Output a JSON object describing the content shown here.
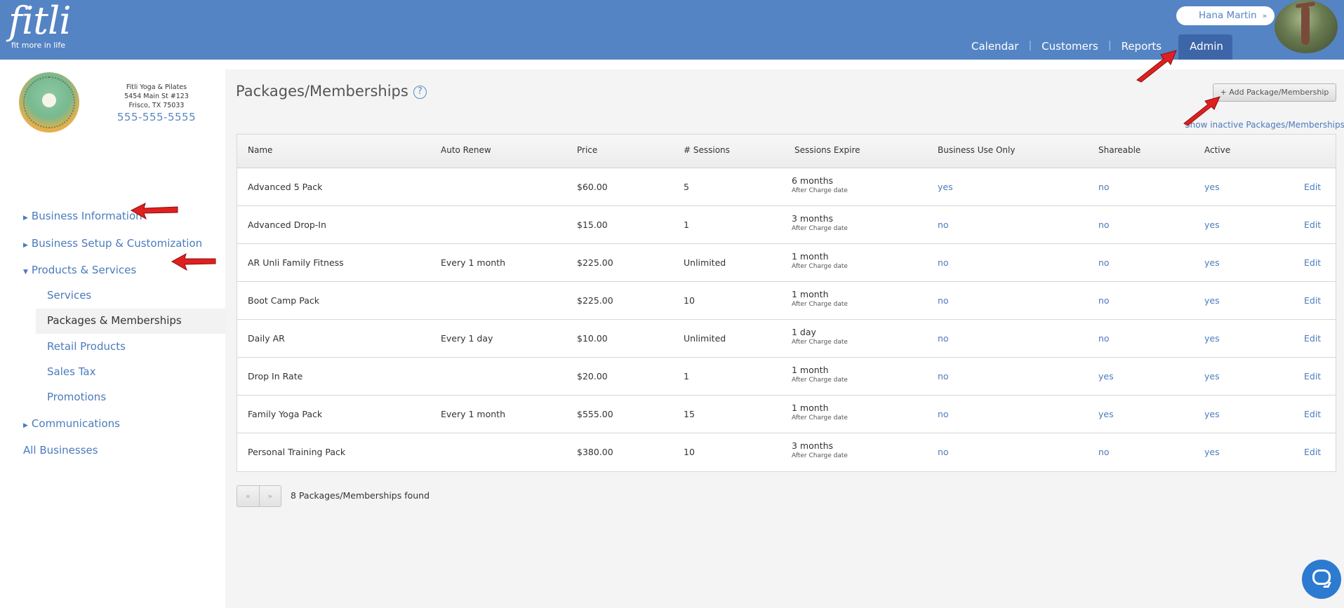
{
  "header": {
    "logo_word": "fitli",
    "logo_tagline": "fit more in life",
    "user_name": "Hana Martin",
    "user_chevron": "»",
    "nav": [
      {
        "label": "Calendar"
      },
      {
        "label": "Customers"
      },
      {
        "label": "Reports"
      },
      {
        "label": "Admin",
        "active": true
      }
    ],
    "nav_separator": "|"
  },
  "business": {
    "name": "Fitli Yoga & Pilates",
    "address1": "5454 Main St #123",
    "address2": "Frisco, TX 75033",
    "phone": "555-555-5555"
  },
  "sidebar": {
    "items": [
      {
        "label": "Business Information",
        "expanded": false
      },
      {
        "label": "Business Setup & Customization",
        "expanded": false
      },
      {
        "label": "Products & Services",
        "expanded": true
      },
      {
        "label": "Communications",
        "expanded": false
      },
      {
        "label": "All Businesses"
      }
    ],
    "subitems": [
      {
        "label": "Services"
      },
      {
        "label": "Packages & Memberships",
        "current": true
      },
      {
        "label": "Retail Products"
      },
      {
        "label": "Sales Tax"
      },
      {
        "label": "Promotions"
      }
    ]
  },
  "main": {
    "title": "Packages/Memberships",
    "help_icon": "?",
    "add_button": "+ Add Package/Membership",
    "show_inactive": "Show inactive Packages/Memberships",
    "columns": [
      "Name",
      "Auto Renew",
      "Price",
      "# Sessions",
      "Sessions Expire",
      "Business Use Only",
      "Shareable",
      "Active",
      ""
    ],
    "rows": [
      {
        "name": "Advanced 5 Pack",
        "auto_renew": "",
        "price": "$60.00",
        "sessions": "5",
        "expire": "6 months",
        "expire_note": "After Charge date",
        "business_use_only": "yes",
        "shareable": "no",
        "active": "yes",
        "action": "Edit"
      },
      {
        "name": "Advanced Drop-In",
        "auto_renew": "",
        "price": "$15.00",
        "sessions": "1",
        "expire": "3 months",
        "expire_note": "After Charge date",
        "business_use_only": "no",
        "shareable": "no",
        "active": "yes",
        "action": "Edit"
      },
      {
        "name": "AR Unli Family Fitness",
        "auto_renew": "Every 1 month",
        "price": "$225.00",
        "sessions": "Unlimited",
        "expire": "1 month",
        "expire_note": "After Charge date",
        "business_use_only": "no",
        "shareable": "no",
        "active": "yes",
        "action": "Edit"
      },
      {
        "name": "Boot Camp Pack",
        "auto_renew": "",
        "price": "$225.00",
        "sessions": "10",
        "expire": "1 month",
        "expire_note": "After Charge date",
        "business_use_only": "no",
        "shareable": "no",
        "active": "yes",
        "action": "Edit"
      },
      {
        "name": "Daily AR",
        "auto_renew": "Every 1 day",
        "price": "$10.00",
        "sessions": "Unlimited",
        "expire": "1 day",
        "expire_note": "After Charge date",
        "business_use_only": "no",
        "shareable": "no",
        "active": "yes",
        "action": "Edit"
      },
      {
        "name": "Drop In Rate",
        "auto_renew": "",
        "price": "$20.00",
        "sessions": "1",
        "expire": "1 month",
        "expire_note": "After Charge date",
        "business_use_only": "no",
        "shareable": "yes",
        "active": "yes",
        "action": "Edit"
      },
      {
        "name": "Family Yoga Pack",
        "auto_renew": "Every 1 month",
        "price": "$555.00",
        "sessions": "15",
        "expire": "1 month",
        "expire_note": "After Charge date",
        "business_use_only": "no",
        "shareable": "yes",
        "active": "yes",
        "action": "Edit"
      },
      {
        "name": "Personal Training Pack",
        "auto_renew": "",
        "price": "$380.00",
        "sessions": "10",
        "expire": "3 months",
        "expire_note": "After Charge date",
        "business_use_only": "no",
        "shareable": "no",
        "active": "yes",
        "action": "Edit"
      }
    ],
    "pager_prev": "«",
    "pager_next": "»",
    "found_text": "8 Packages/Memberships found"
  },
  "colors": {
    "header_bg": "#5584c4",
    "active_tab_bg": "#3d66a8",
    "link": "#4a7bbd",
    "annotation_arrow": "#e02020",
    "chat_button": "#2d7bd1"
  },
  "icons": [
    "chevron-down-icon",
    "caret-right-icon",
    "caret-down-icon",
    "help-icon",
    "chat-icon",
    "annotation-arrow-icon"
  ]
}
